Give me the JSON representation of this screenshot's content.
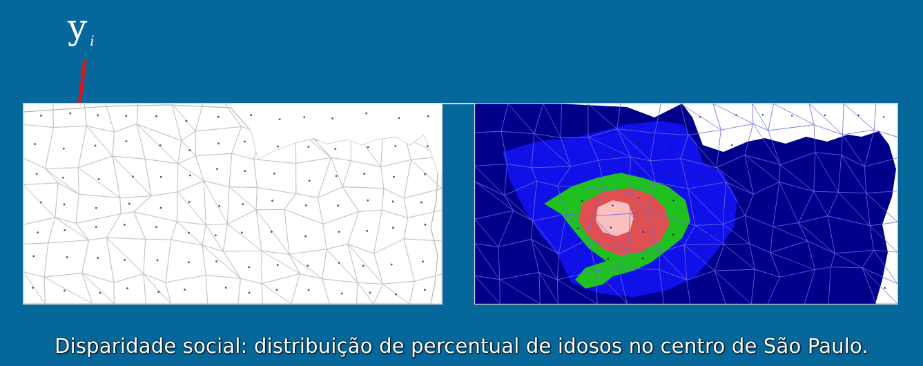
{
  "annotation": {
    "variable": "y",
    "subscript": "i",
    "arrow_color": "#e0141a"
  },
  "maps": [
    {
      "name": "raw-districts",
      "style": "outline-map"
    },
    {
      "name": "smoothed-surface",
      "style": "filled-choropleth",
      "colors": [
        "#fac0c0",
        "#e05050",
        "#20c020",
        "#1010e8",
        "#00008a"
      ]
    }
  ],
  "caption": "Disparidade social: distribuição de percentual de idosos no centro de São Paulo."
}
